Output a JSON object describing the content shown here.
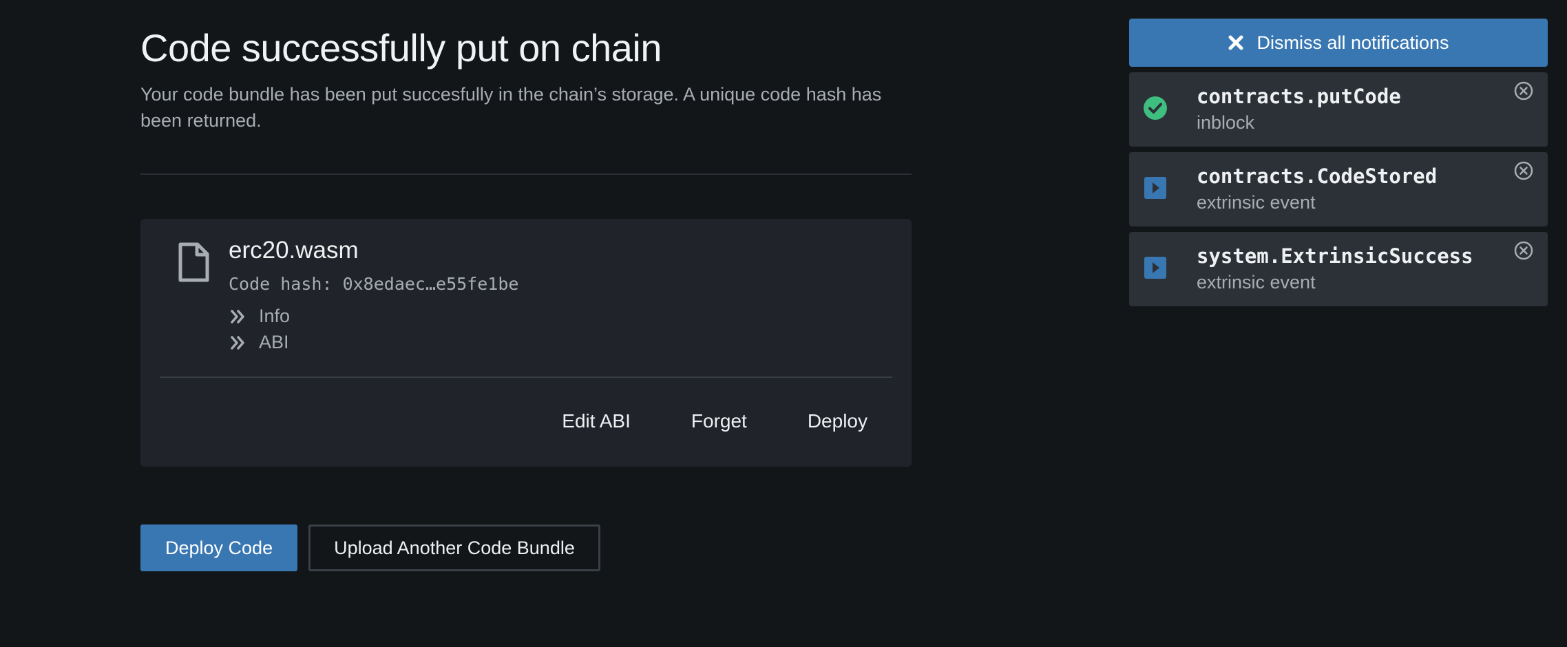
{
  "header": {
    "title": "Code successfully put on chain",
    "description": "Your code bundle has been put succesfully in the chain’s storage. A unique code hash has been returned."
  },
  "code_card": {
    "icon": "file-icon",
    "file_name": "erc20.wasm",
    "code_hash": "Code hash: 0x8edaec…e55fe1be",
    "expanders": [
      {
        "label": "Info",
        "icon": "double-chevron-right-icon"
      },
      {
        "label": "ABI",
        "icon": "double-chevron-right-icon"
      }
    ],
    "actions": {
      "edit_abi": "Edit ABI",
      "forget": "Forget",
      "deploy": "Deploy"
    }
  },
  "buttons": {
    "deploy_code": "Deploy Code",
    "upload_another": "Upload Another Code Bundle"
  },
  "notifications": {
    "dismiss_all": "Dismiss all notifications",
    "items": [
      {
        "title": "contracts.putCode",
        "subtitle": "inblock",
        "icon": "check-circle-icon"
      },
      {
        "title": "contracts.CodeStored",
        "subtitle": "extrinsic event",
        "icon": "play-square-icon"
      },
      {
        "title": "system.ExtrinsicSuccess",
        "subtitle": "extrinsic event",
        "icon": "play-square-icon"
      }
    ]
  },
  "colors": {
    "background": "#131619",
    "card": "#20242a",
    "accent": "#3977b3",
    "success": "#3fbf7f",
    "notification_bg": "#2b3137"
  }
}
